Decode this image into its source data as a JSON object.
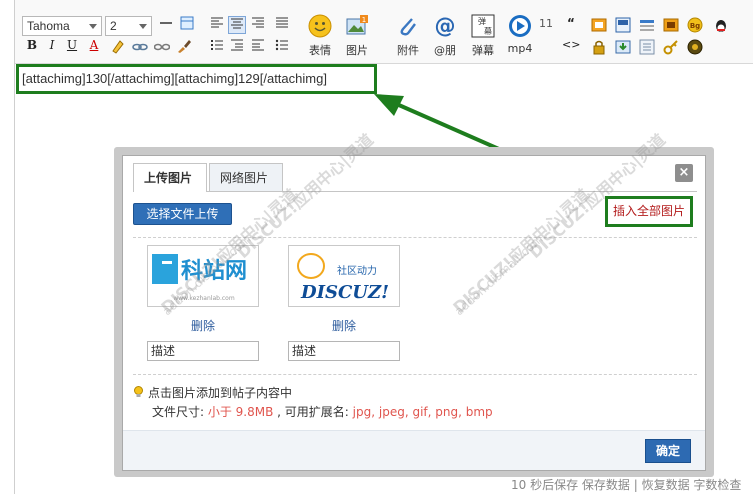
{
  "toolbar": {
    "font_family": "Tahoma",
    "font_size": "2",
    "row1_buttons": [
      "hr-icon",
      "table-icon",
      "align-left-icon",
      "align-center-icon",
      "align-right-icon",
      "align-justify-icon"
    ],
    "format_labels": {
      "bold": "B",
      "italic": "I",
      "underline": "U",
      "color": "A"
    },
    "big_buttons": [
      {
        "icon": "smiley-icon",
        "label": "表情"
      },
      {
        "icon": "image-icon",
        "label": "图片"
      },
      {
        "icon": "attachment-icon",
        "label": "附件"
      },
      {
        "icon": "at-icon",
        "label": "@朋"
      },
      {
        "icon": "danmu-icon",
        "label": "弹幕"
      },
      {
        "icon": "mp4-icon",
        "label": "mp4"
      }
    ],
    "count_badge": "11",
    "quote_label": "“",
    "code_label": "<>"
  },
  "editor": {
    "content": "[attachimg]130[/attachimg][attachimg]129[/attachimg]"
  },
  "dialog": {
    "tabs": [
      {
        "label": "上传图片",
        "active": true
      },
      {
        "label": "网络图片",
        "active": false
      }
    ],
    "close_label": "×",
    "upload_button": "选择文件上传",
    "insert_all": "插入全部图片",
    "images": [
      {
        "alt": "科站网",
        "delete_label": "删除",
        "desc_placeholder": "描述"
      },
      {
        "alt": "社区动力 DISCUZ!",
        "delete_label": "删除",
        "desc_placeholder": "描述"
      }
    ],
    "tip": "点击图片添加到帖子内容中",
    "size_prefix": "文件尺寸: ",
    "size_limit": "小于 9.8MB",
    "ext_prefix": " , 可用扩展名: ",
    "extensions": "jpg, jpeg, gif, png, bmp",
    "ok_button": "确定"
  },
  "status_bar": "10 秒后保存  保存数据 | 恢复数据    字数检查",
  "watermark": {
    "line1": "DISCUZ!应用中心|灵道",
    "line2": "addon.dismall.com"
  },
  "thumb_text": {
    "kezhan": "科站网",
    "kezhan_small": "www.kezhanlab.com",
    "discuz_top": "社区动力",
    "discuz_main": "DISCUZ!"
  },
  "colors": {
    "highlight_green": "#1e7d1e",
    "primary_blue": "#2f6fb7",
    "insert_red": "#b31b1b",
    "size_red": "#e0554e"
  }
}
